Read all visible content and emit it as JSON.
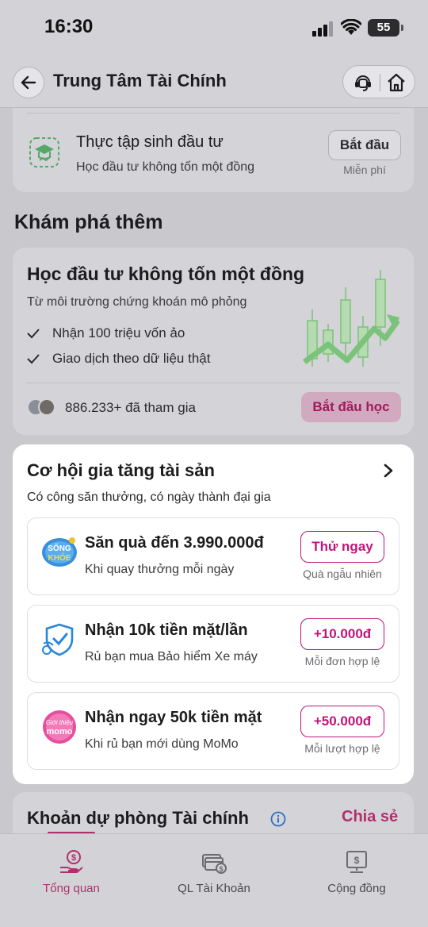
{
  "status_bar": {
    "time": "16:30",
    "battery": "55"
  },
  "header": {
    "title": "Trung Tâm Tài Chính"
  },
  "intern": {
    "title": "Thực tập sinh đầu tư",
    "subtitle": "Học đầu tư không tốn một đồng",
    "button": "Bắt đầu",
    "note": "Miễn phí"
  },
  "explore": {
    "section_title": "Khám phá thêm",
    "title": "Học đầu tư không tốn một đồng",
    "subtitle": "Từ môi trường chứng khoán mô phỏng",
    "bullets": [
      "Nhận 100 triệu vốn ảo",
      "Giao dịch theo dữ liệu thật"
    ],
    "joined": "886.233+ đã tham gia",
    "button": "Bắt đầu học"
  },
  "opportunities": {
    "title": "Cơ hội gia tăng tài sản",
    "subtitle": "Có công săn thưởng, có ngày thành đại gia",
    "offers": [
      {
        "icon": "song-khoe-logo-icon",
        "title": "Săn quà đến 3.990.000đ",
        "subtitle": "Khi quay thưởng mỗi ngày",
        "cta": "Thử ngay",
        "note": "Quà ngẫu nhiên"
      },
      {
        "icon": "motorbike-shield-icon",
        "title": "Nhận 10k tiền mặt/lần",
        "subtitle": "Rủ bạn mua Bảo hiểm Xe máy",
        "cta": "+10.000đ",
        "note": "Mỗi đơn hợp lệ"
      },
      {
        "icon": "gioi-thieu-momo-logo-icon",
        "title": "Nhận ngay 50k tiền mặt",
        "subtitle": "Khi rủ bạn mới dùng MoMo",
        "cta": "+50.000đ",
        "note": "Mỗi lượt hợp lệ"
      }
    ],
    "logo_text": {
      "song_khoe_1": "SỐNG",
      "song_khoe_2": "KHỎE",
      "gioi_thieu": "Giới thiệu",
      "momo": "momo"
    }
  },
  "reserve": {
    "title": "Khoản dự phòng Tài chính",
    "share": "Chia sẻ"
  },
  "bottom_nav": [
    {
      "label": "Tổng quan",
      "active": true
    },
    {
      "label": "QL Tài Khoản",
      "active": false
    },
    {
      "label": "Cộng đồng",
      "active": false
    }
  ],
  "colors": {
    "accent": "#c0157a",
    "accent_dark": "#a3195b",
    "overlay_bg": "#c9c8cd",
    "card_bg": "#ffffff",
    "chart_green": "#7bc27a"
  }
}
